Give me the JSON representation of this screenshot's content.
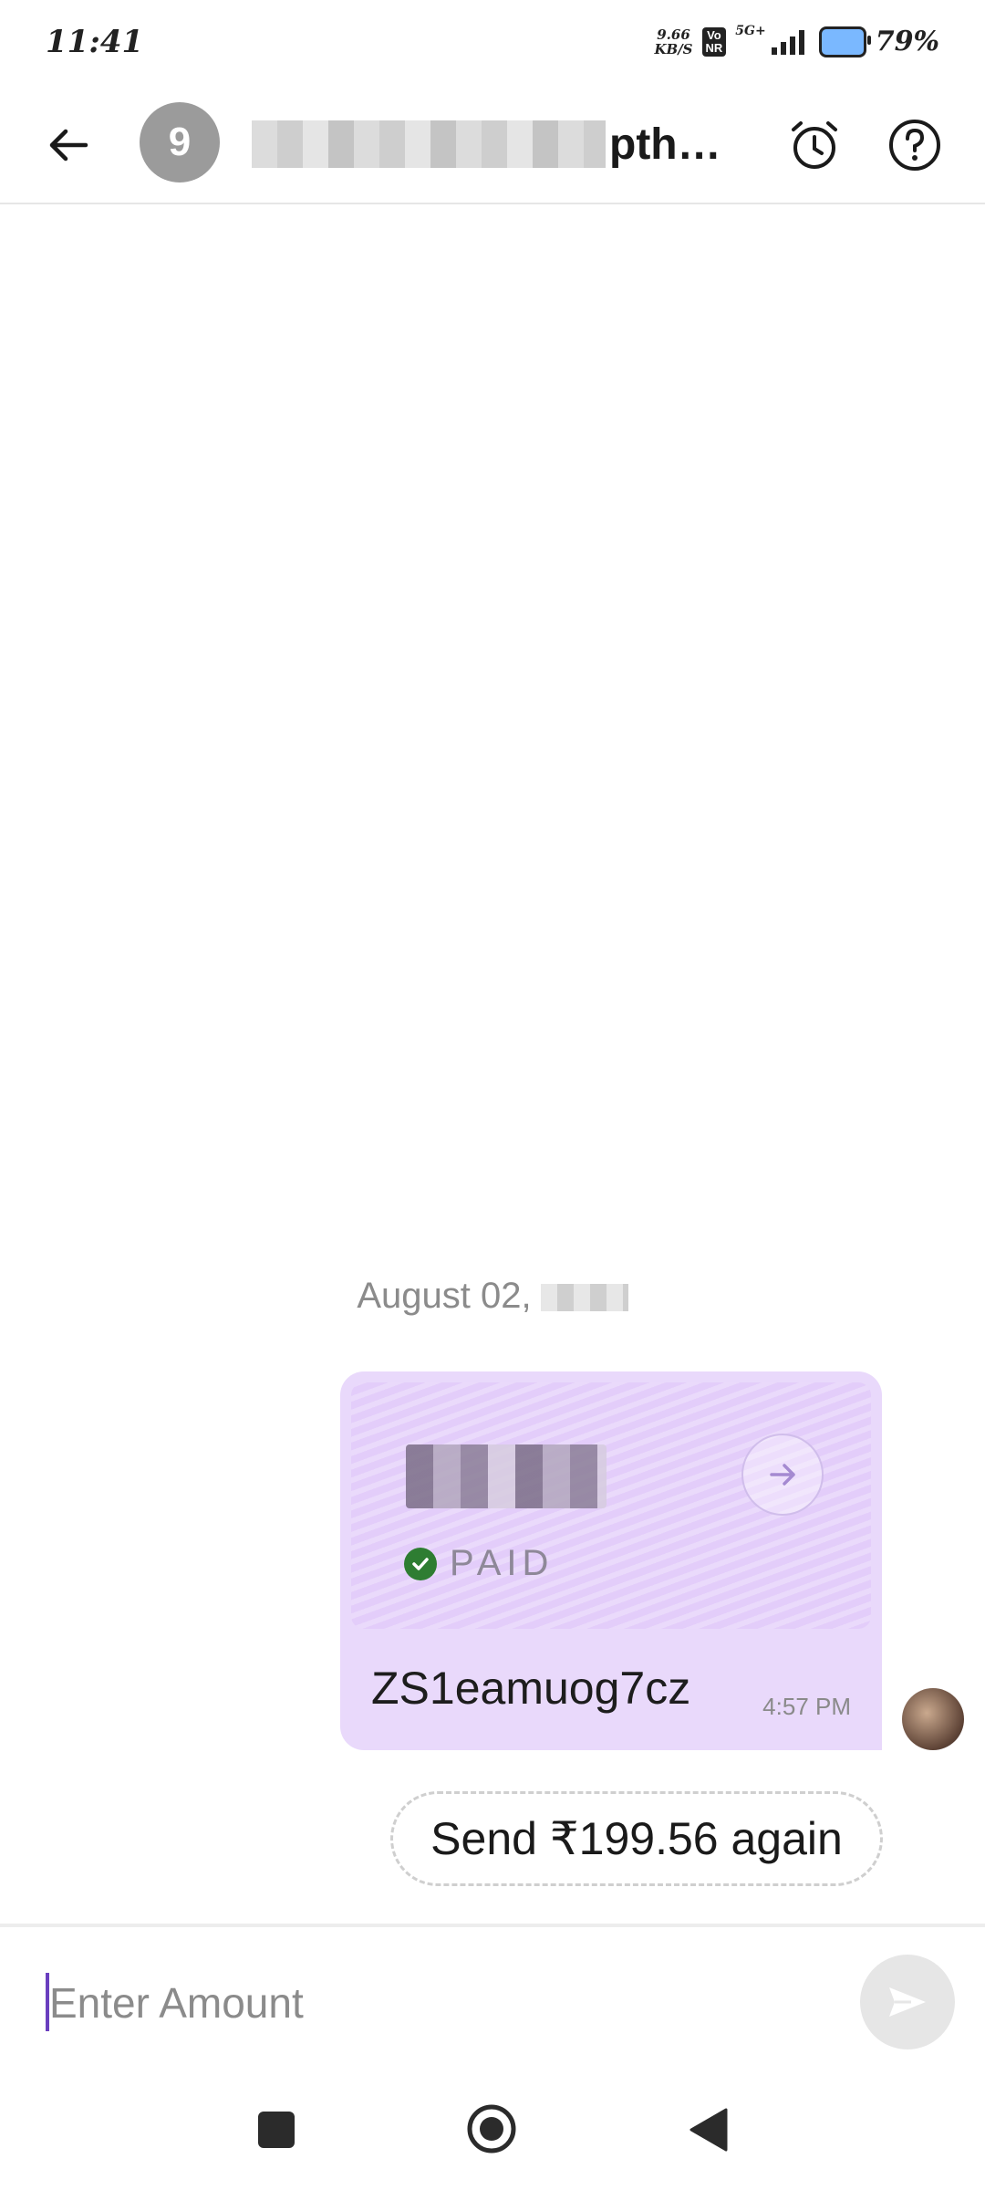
{
  "status_bar": {
    "time": "11:41",
    "net_speed": "9.66\nKB/S",
    "volte": "Vo\nNR",
    "network": "5G+",
    "battery_pct": "79%"
  },
  "header": {
    "avatar_initial": "9",
    "title_visible": "pth…",
    "icons": [
      "back-arrow-icon",
      "alarm-clock-icon",
      "help-icon"
    ]
  },
  "chat": {
    "date": "August 02,",
    "payment": {
      "status": "PAID",
      "transaction_id": "ZS1eamuog7cz",
      "time": "4:57 PM"
    },
    "send_again_label": "Send ₹199.56 again"
  },
  "input": {
    "placeholder": "Enter Amount",
    "value": ""
  },
  "colors": {
    "accent": "#6a3fbf",
    "card_bg": "#e9d9fb",
    "paid_check": "#2e7d32"
  }
}
